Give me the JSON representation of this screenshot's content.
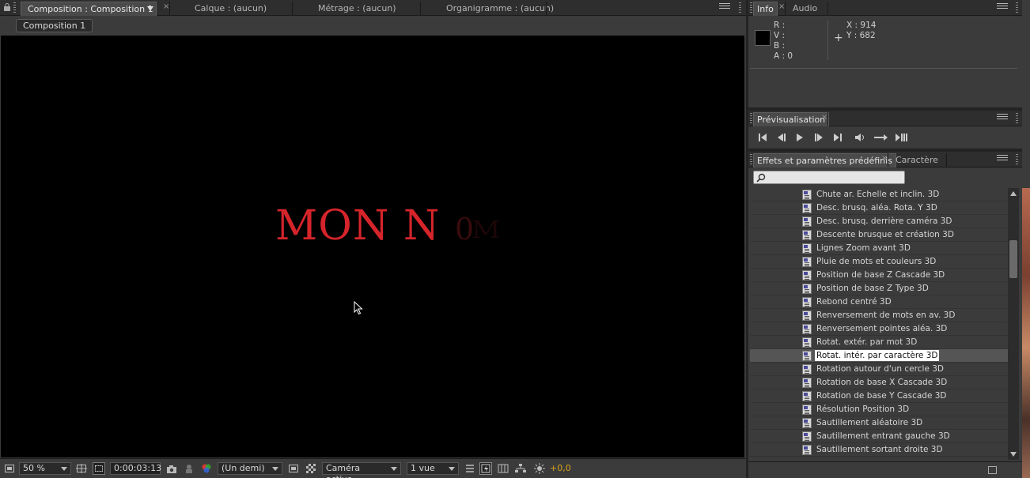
{
  "composition_panel": {
    "tabs": [
      {
        "label": "Composition : Composition 1",
        "active": true
      },
      {
        "label": "Calque : (aucun)",
        "active": false
      },
      {
        "label": "Métrage : (aucun)",
        "active": false
      },
      {
        "label": "Organigramme : (aucun)",
        "active": false
      }
    ],
    "breadcrumb": "Composition 1",
    "viewer": {
      "title_main": "MON N",
      "title_fading_1": "0",
      "title_fading_2": "M",
      "title_color": "#d6242b",
      "background": "#000000"
    },
    "status_bar": {
      "zoom": "50 %",
      "timecode": "0:00:03:13",
      "resolution": "(Un demi)",
      "camera": "Caméra active",
      "views": "1 vue",
      "exposure": "+0,0"
    }
  },
  "info_panel": {
    "tabs": [
      {
        "label": "Info",
        "active": true
      },
      {
        "label": "Audio",
        "active": false
      }
    ],
    "r_label": "R :",
    "v_label": "V :",
    "b_label": "B :",
    "a_label": "A : 0",
    "x_label": "X : 914",
    "y_label": "Y : 682",
    "swatch_color": "#000000"
  },
  "preview_panel": {
    "tabs": [
      {
        "label": "Prévisualisation",
        "active": true
      }
    ]
  },
  "effects_panel": {
    "tabs": [
      {
        "label": "Effets et paramètres prédéfinis",
        "active": true
      },
      {
        "label": "Caractère",
        "active": false
      }
    ],
    "search_value": "",
    "items": [
      {
        "label": "Chute ar. Echelle et inclin. 3D",
        "selected": false
      },
      {
        "label": "Desc. brusq. aléa. Rota. Y 3D",
        "selected": false
      },
      {
        "label": "Desc. brusq. derrière caméra 3D",
        "selected": false
      },
      {
        "label": "Descente brusque et création 3D",
        "selected": false
      },
      {
        "label": "Lignes Zoom avant 3D",
        "selected": false
      },
      {
        "label": "Pluie de mots et couleurs 3D",
        "selected": false
      },
      {
        "label": "Position de base Z Cascade 3D",
        "selected": false
      },
      {
        "label": "Position de base Z Type 3D",
        "selected": false
      },
      {
        "label": "Rebond centré 3D",
        "selected": false
      },
      {
        "label": "Renversement de mots en av. 3D",
        "selected": false
      },
      {
        "label": "Renversement pointes aléa. 3D",
        "selected": false
      },
      {
        "label": "Rotat. extér. par mot 3D",
        "selected": false
      },
      {
        "label": "Rotat. intér. par caractère 3D",
        "selected": true
      },
      {
        "label": "Rotation autour d'un cercle 3D",
        "selected": false
      },
      {
        "label": "Rotation de base X Cascade 3D",
        "selected": false
      },
      {
        "label": "Rotation de base Y Cascade 3D",
        "selected": false
      },
      {
        "label": "Résolution Position 3D",
        "selected": false
      },
      {
        "label": "Sautillement aléatoire 3D",
        "selected": false
      },
      {
        "label": "Sautillement entrant gauche 3D",
        "selected": false
      },
      {
        "label": "Sautillement sortant droite 3D",
        "selected": false
      }
    ]
  },
  "colors": {
    "panel_bg": "#3b3b3b",
    "accent_exposure": "#d6a41a",
    "selected_row": "#555555"
  }
}
